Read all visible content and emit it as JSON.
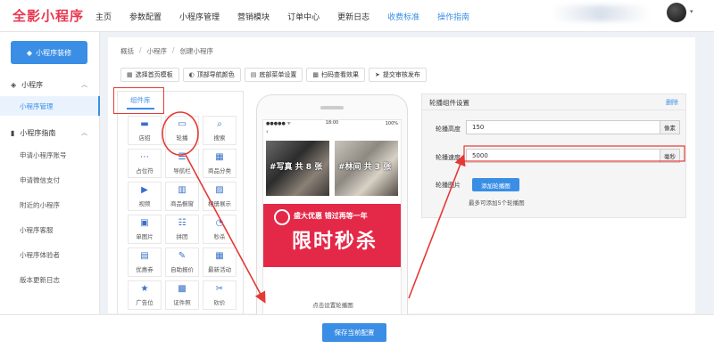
{
  "header": {
    "logo_text": "全影小程序",
    "nav": [
      {
        "label": "主页",
        "highlight": false
      },
      {
        "label": "参数配置",
        "highlight": false
      },
      {
        "label": "小程序管理",
        "highlight": false
      },
      {
        "label": "营销模块",
        "highlight": false
      },
      {
        "label": "订单中心",
        "highlight": false
      },
      {
        "label": "更新日志",
        "highlight": false
      },
      {
        "label": "收费标准",
        "highlight": true
      },
      {
        "label": "操作指南",
        "highlight": true
      }
    ]
  },
  "sidebar": {
    "decor_button": "小程序装修",
    "group_program": "小程序",
    "item_manage": "小程序管理",
    "group_guide": "小程序指南",
    "guide_items": [
      "申请小程序账号",
      "申请微信支付",
      "附近的小程序",
      "小程序客服",
      "小程序体验者",
      "版本更新日志"
    ]
  },
  "breadcrumb": [
    "概括",
    "小程序",
    "创建小程序"
  ],
  "toolbar": [
    {
      "icon": "grid-icon",
      "glyph": "▦",
      "label": "选择首页模板"
    },
    {
      "icon": "palette-icon",
      "glyph": "◐",
      "label": "顶部导航颜色"
    },
    {
      "icon": "menu-icon",
      "glyph": "▤",
      "label": "底部菜单设置"
    },
    {
      "icon": "qrcode-icon",
      "glyph": "▩",
      "label": "扫码查看效果"
    },
    {
      "icon": "send-icon",
      "glyph": "➤",
      "label": "提交审核发布"
    }
  ],
  "library": {
    "tab": "组件库",
    "components": [
      {
        "name": "store-icon",
        "glyph": "▬",
        "label": "店招"
      },
      {
        "name": "carousel-icon",
        "glyph": "▭",
        "label": "轮播"
      },
      {
        "name": "search-icon",
        "glyph": "⌕",
        "label": "搜索"
      },
      {
        "name": "placeholder-icon",
        "glyph": "⋯",
        "label": "占位符"
      },
      {
        "name": "navbar-icon",
        "glyph": "☰",
        "label": "导航栏"
      },
      {
        "name": "category-icon",
        "glyph": "▦",
        "label": "商品分类"
      },
      {
        "name": "video-icon",
        "glyph": "▶",
        "label": "视频"
      },
      {
        "name": "shelf-icon",
        "glyph": "▥",
        "label": "商品橱窗"
      },
      {
        "name": "album-icon",
        "glyph": "▨",
        "label": "相册展示"
      },
      {
        "name": "image-icon",
        "glyph": "▣",
        "label": "单图片"
      },
      {
        "name": "group-icon",
        "glyph": "☷",
        "label": "拼团"
      },
      {
        "name": "flash-icon",
        "glyph": "◔",
        "label": "秒杀"
      },
      {
        "name": "coupon-icon",
        "glyph": "▤",
        "label": "优惠券"
      },
      {
        "name": "quote-icon",
        "glyph": "✎",
        "label": "自助报价"
      },
      {
        "name": "news-icon",
        "glyph": "▦",
        "label": "最新活动"
      },
      {
        "name": "ad-icon",
        "glyph": "★",
        "label": "广告位"
      },
      {
        "name": "certificate-icon",
        "glyph": "▩",
        "label": "证件照"
      },
      {
        "name": "bargain-icon",
        "glyph": "✂",
        "label": "砍价"
      }
    ]
  },
  "phone": {
    "time": "18:00",
    "signal": "●●●●● ᯤ",
    "battery": "100%",
    "back": "‹",
    "thumb1": "#写真  共 8 张",
    "thumb2": "#林间  共 3 张",
    "banner_small": "盛大优惠  错过再等一年",
    "banner_big": "限时秒杀",
    "set_banner": "点击设置轮播图"
  },
  "settings": {
    "title": "轮播组件设置",
    "delete": "删除",
    "height_label": "轮播高度",
    "height_value": "150",
    "height_unit": "像素",
    "speed_label": "轮播速度",
    "speed_value": "5000",
    "speed_unit": "毫秒",
    "image_label": "轮播图片",
    "add_button": "添加轮播图",
    "hint": "最多可添加5个轮播图"
  },
  "save_button": "保存当前配置",
  "colors": {
    "accent": "#3a8ee6",
    "brand": "#e8374f",
    "banner": "#e42848",
    "annotation": "#e53935"
  }
}
